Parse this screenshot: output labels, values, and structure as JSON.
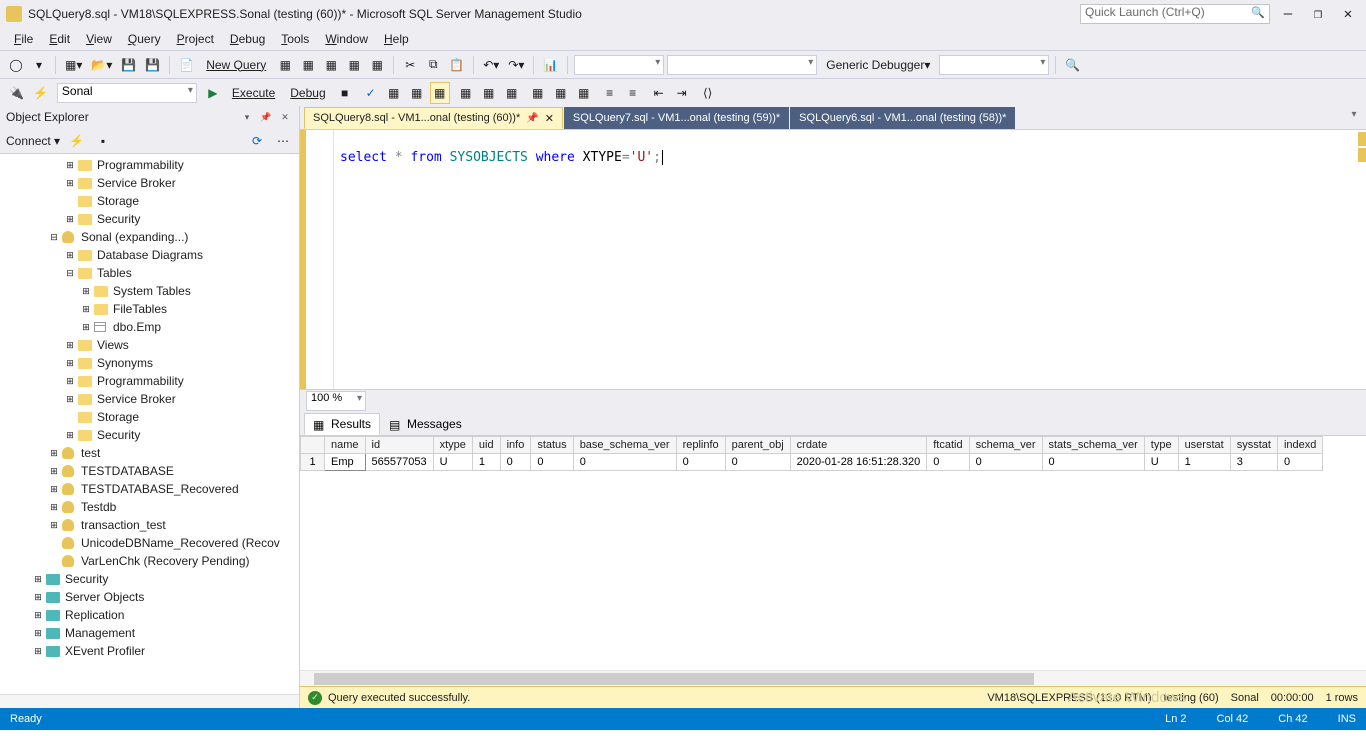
{
  "window": {
    "title": "SQLQuery8.sql - VM18\\SQLEXPRESS.Sonal (testing (60))* - Microsoft SQL Server Management Studio",
    "quicklaunch_placeholder": "Quick Launch (Ctrl+Q)"
  },
  "menu": [
    "File",
    "Edit",
    "View",
    "Query",
    "Project",
    "Debug",
    "Tools",
    "Window",
    "Help"
  ],
  "toolbar1": {
    "new_query": "New Query",
    "debugger_label": "Generic Debugger",
    "db_dropdown": "Sonal",
    "execute": "Execute",
    "debug": "Debug"
  },
  "object_explorer": {
    "title": "Object Explorer",
    "connect": "Connect"
  },
  "tree": [
    {
      "indent": 4,
      "exp": "+",
      "icon": "folder",
      "label": "Programmability"
    },
    {
      "indent": 4,
      "exp": "+",
      "icon": "folder",
      "label": "Service Broker"
    },
    {
      "indent": 4,
      "exp": "",
      "icon": "folder",
      "label": "Storage"
    },
    {
      "indent": 4,
      "exp": "+",
      "icon": "folder",
      "label": "Security"
    },
    {
      "indent": 3,
      "exp": "−",
      "icon": "db",
      "label": "Sonal (expanding...)"
    },
    {
      "indent": 4,
      "exp": "+",
      "icon": "folder",
      "label": "Database Diagrams"
    },
    {
      "indent": 4,
      "exp": "−",
      "icon": "folder",
      "label": "Tables"
    },
    {
      "indent": 5,
      "exp": "+",
      "icon": "folder",
      "label": "System Tables"
    },
    {
      "indent": 5,
      "exp": "+",
      "icon": "folder",
      "label": "FileTables"
    },
    {
      "indent": 5,
      "exp": "+",
      "icon": "tbl",
      "label": "dbo.Emp"
    },
    {
      "indent": 4,
      "exp": "+",
      "icon": "folder",
      "label": "Views"
    },
    {
      "indent": 4,
      "exp": "+",
      "icon": "folder",
      "label": "Synonyms"
    },
    {
      "indent": 4,
      "exp": "+",
      "icon": "folder",
      "label": "Programmability"
    },
    {
      "indent": 4,
      "exp": "+",
      "icon": "folder",
      "label": "Service Broker"
    },
    {
      "indent": 4,
      "exp": "",
      "icon": "folder",
      "label": "Storage"
    },
    {
      "indent": 4,
      "exp": "+",
      "icon": "folder",
      "label": "Security"
    },
    {
      "indent": 3,
      "exp": "+",
      "icon": "db",
      "label": "test"
    },
    {
      "indent": 3,
      "exp": "+",
      "icon": "db",
      "label": "TESTDATABASE"
    },
    {
      "indent": 3,
      "exp": "+",
      "icon": "db",
      "label": "TESTDATABASE_Recovered"
    },
    {
      "indent": 3,
      "exp": "+",
      "icon": "db",
      "label": "Testdb"
    },
    {
      "indent": 3,
      "exp": "+",
      "icon": "db",
      "label": "transaction_test"
    },
    {
      "indent": 3,
      "exp": "",
      "icon": "db",
      "label": "UnicodeDBName_Recovered (Recov"
    },
    {
      "indent": 3,
      "exp": "",
      "icon": "db",
      "label": "VarLenChk (Recovery Pending)"
    },
    {
      "indent": 2,
      "exp": "+",
      "icon": "folder-teal",
      "label": "Security"
    },
    {
      "indent": 2,
      "exp": "+",
      "icon": "folder-teal",
      "label": "Server Objects"
    },
    {
      "indent": 2,
      "exp": "+",
      "icon": "folder-teal",
      "label": "Replication"
    },
    {
      "indent": 2,
      "exp": "+",
      "icon": "folder-teal",
      "label": "Management"
    },
    {
      "indent": 2,
      "exp": "+",
      "icon": "folder-teal",
      "label": "XEvent Profiler"
    }
  ],
  "tabs": [
    {
      "label": "SQLQuery8.sql - VM1...onal (testing (60))*",
      "active": true
    },
    {
      "label": "SQLQuery7.sql - VM1...onal (testing (59))*",
      "active": false
    },
    {
      "label": "SQLQuery6.sql - VM1...onal (testing (58))*",
      "active": false
    }
  ],
  "code": {
    "kw1": "select",
    "star": "*",
    "kw2": "from",
    "obj": "SYSOBJECTS",
    "kw3": "where",
    "col": "XTYPE",
    "eq": "=",
    "str": "'U'",
    "semi": ";"
  },
  "zoom": "100 %",
  "result_tabs": {
    "results": "Results",
    "messages": "Messages"
  },
  "grid": {
    "headers": [
      "",
      "name",
      "id",
      "xtype",
      "uid",
      "info",
      "status",
      "base_schema_ver",
      "replinfo",
      "parent_obj",
      "crdate",
      "ftcatid",
      "schema_ver",
      "stats_schema_ver",
      "type",
      "userstat",
      "sysstat",
      "indexd"
    ],
    "row": [
      "1",
      "Emp",
      "565577053",
      "U",
      "1",
      "0",
      "0",
      "0",
      "0",
      "0",
      "2020-01-28 16:51:28.320",
      "0",
      "0",
      "0",
      "U",
      "1",
      "3",
      "0"
    ]
  },
  "query_status": {
    "msg": "Query executed successfully.",
    "server": "VM18\\SQLEXPRESS (13.0 RTM)",
    "user": "testing (60)",
    "db": "Sonal",
    "time": "00:00:00",
    "rows": "1 rows",
    "watermark1": "Activate Windows"
  },
  "statusbar": {
    "ready": "Ready",
    "ln": "Ln 2",
    "col": "Col 42",
    "ch": "Ch 42",
    "ins": "INS"
  }
}
